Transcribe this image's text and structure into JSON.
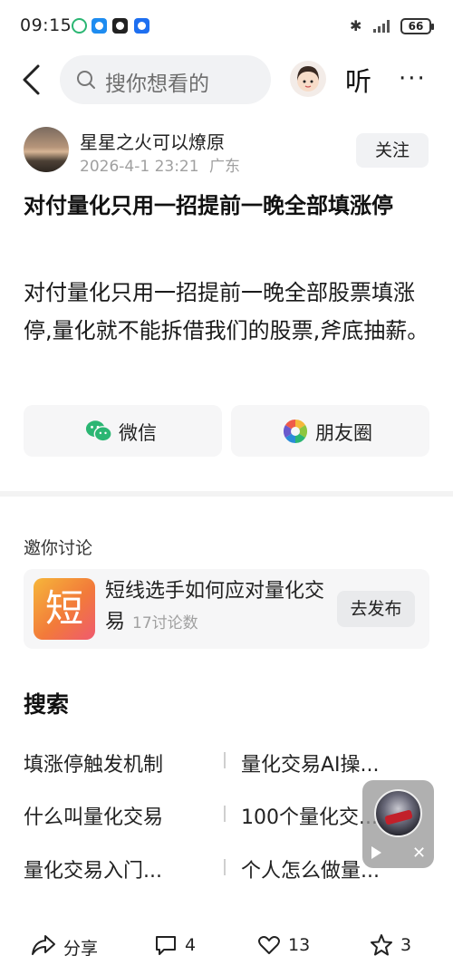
{
  "status_bar": {
    "time": "09:15",
    "battery": "66",
    "icons": [
      "wechat-pay-icon",
      "chat-app-icon",
      "mercedes-app-icon",
      "security-app-icon",
      "bluetooth-icon",
      "signal-icon",
      "battery-icon"
    ]
  },
  "nav": {
    "search_placeholder": "搜你想看的",
    "listen_label": "听",
    "more_label": "···"
  },
  "author": {
    "name": "星星之火可以燎原",
    "date": "2026-4-1  23:21",
    "location": "广东",
    "follow_label": "关注"
  },
  "post": {
    "title": "对付量化只用一招提前一晚全部填涨停",
    "body": "对付量化只用一招提前一晚全部股票填涨停,量化就不能拆借我们的股票,斧底抽薪。"
  },
  "share": {
    "wechat_label": "微信",
    "moments_label": "朋友圈"
  },
  "discussion": {
    "section_label": "邀你讨论",
    "logo_char": "短",
    "topic_title": "短线选手如何应对量化交易",
    "topic_count": "17讨论数",
    "publish_label": "去发布"
  },
  "search": {
    "title": "搜索",
    "suggestions": [
      [
        "填涨停触发机制",
        "量化交易AI操..."
      ],
      [
        "什么叫量化交易",
        "100个量化交..."
      ],
      [
        "量化交易入门...",
        "个人怎么做量..."
      ]
    ]
  },
  "bottom_bar": {
    "share_label": "分享",
    "comments": "4",
    "likes": "13",
    "favorites": "3"
  },
  "colors": {
    "accent_green": "#2bb673",
    "background": "#ffffff",
    "card_bg": "#f6f6f7"
  }
}
